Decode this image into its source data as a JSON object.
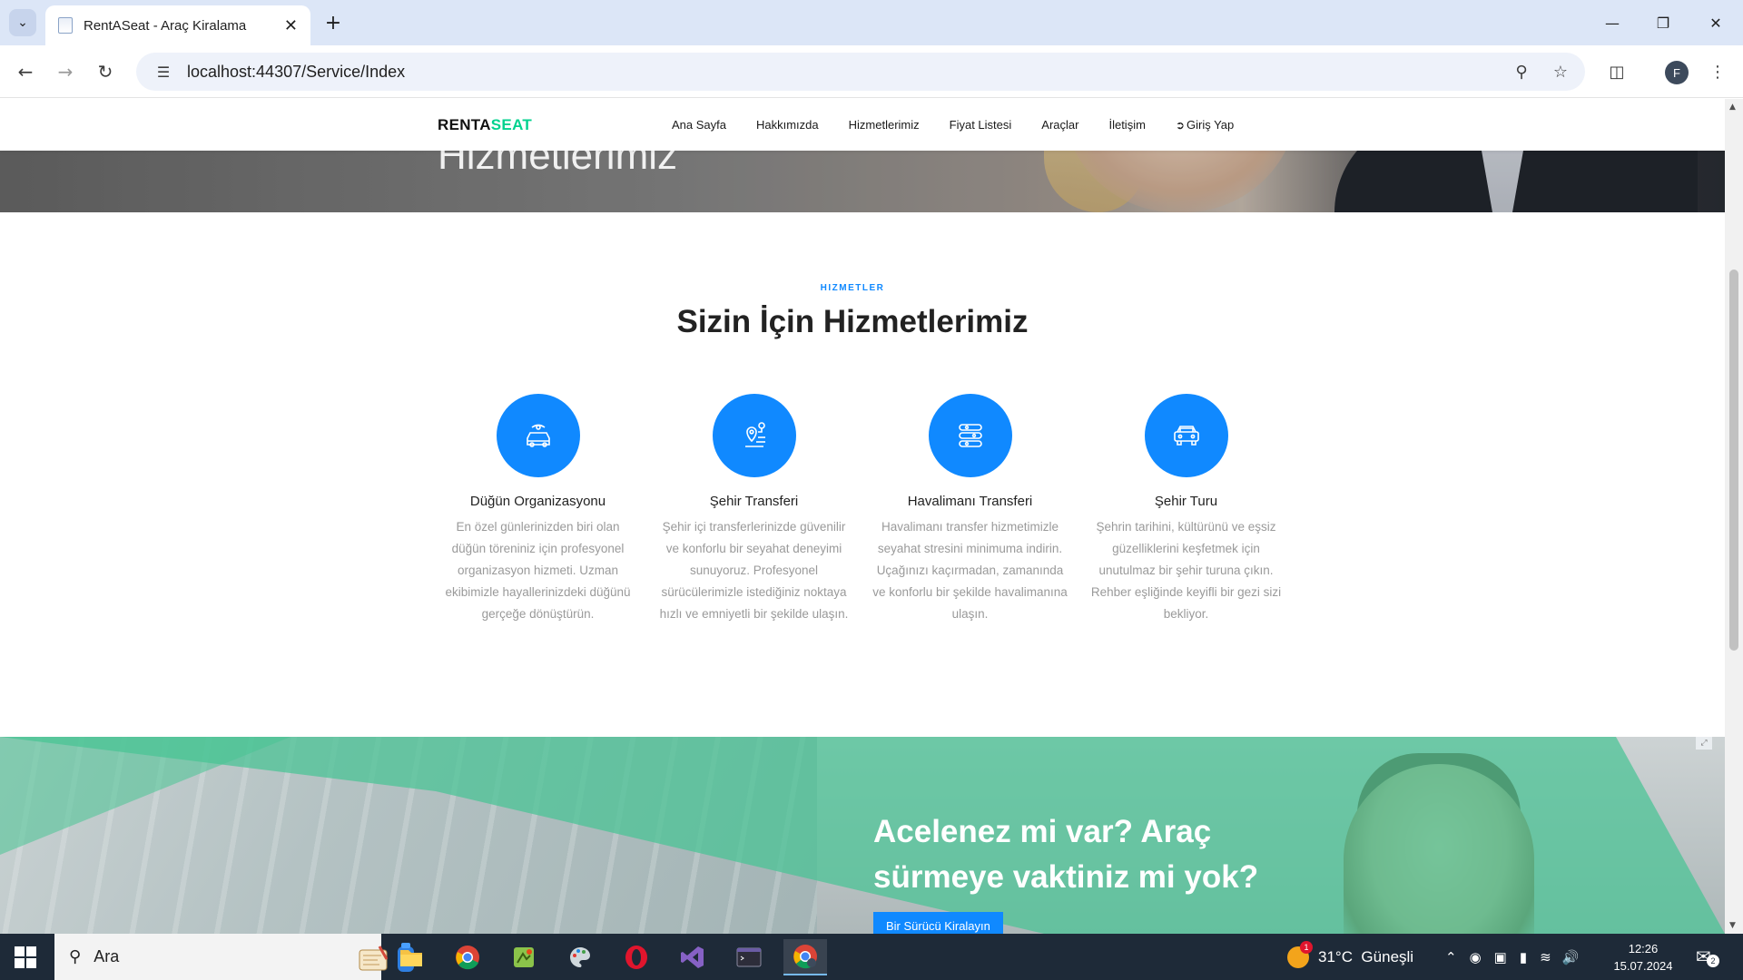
{
  "browser": {
    "tab_title": "RentASeat - Araç Kiralama",
    "url": "localhost:44307/Service/Index",
    "profile_initial": "F"
  },
  "site": {
    "brand_part1": "RENTA",
    "brand_part2": "SEAT",
    "brand_accent": "#01d28e",
    "nav": [
      "Ana Sayfa",
      "Hakkımızda",
      "Hizmetlerimiz",
      "Fiyat Listesi",
      "Araçlar",
      "İletişim",
      "Giriş Yap"
    ],
    "hero_title": "Hizmetlerimiz"
  },
  "services": {
    "subheading": "HIZMETLER",
    "heading": "Sizin İçin Hizmetlerimiz",
    "accent": "#1089ff",
    "items": [
      {
        "icon": "wedding-car-icon",
        "title": "Düğün Organizasyonu",
        "description": "En özel günlerinizden biri olan düğün töreniniz için profesyonel organizasyon hizmeti. Uzman ekibimizle hayallerinizdeki düğünü gerçeğe dönüştürün."
      },
      {
        "icon": "route-pin-icon",
        "title": "Şehir Transferi",
        "description": "Şehir içi transferlerinizde güvenilir ve konforlu bir seyahat deneyimi sunuyoruz. Profesyonel sürücülerimizle istediğiniz noktaya hızlı ve emniyetli bir şekilde ulaşın."
      },
      {
        "icon": "airport-transfer-icon",
        "title": "Havalimanı Transferi",
        "description": "Havalimanı transfer hizmetimizle seyahat stresini minimuma indirin. Uçağınızı kaçırmadan, zamanında ve konforlu bir şekilde havalimanına ulaşın."
      },
      {
        "icon": "city-tour-car-icon",
        "title": "Şehir Turu",
        "description": "Şehrin tarihini, kültürünü ve eşsiz güzelliklerini keşfetmek için unutulmaz bir şehir turuna çıkın. Rehber eşliğinde keyifli bir gezi sizi bekliyor."
      }
    ]
  },
  "promo": {
    "title": "Acelenez mi var? Araç sürmeye vaktiniz mi yok?",
    "button": "Bir Sürücü Kiralayın"
  },
  "taskbar": {
    "search_placeholder": "Ara",
    "weather": "31°C  Güneşli",
    "weather_badge": "1",
    "time": "12:26",
    "date": "15.07.2024",
    "notifications": "2"
  }
}
